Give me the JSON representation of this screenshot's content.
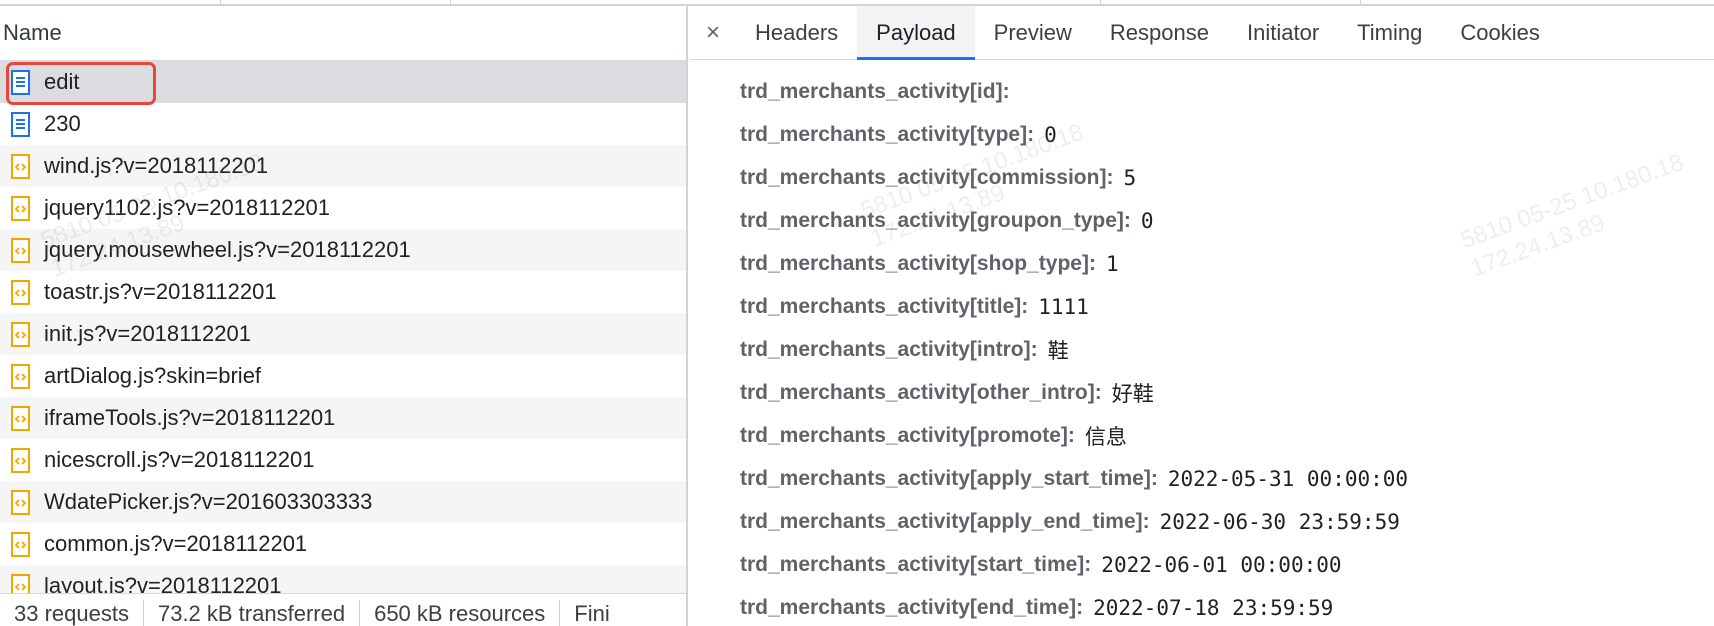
{
  "requests_panel": {
    "column_header": "Name",
    "rows": [
      {
        "name": "edit",
        "icon": "document-icon"
      },
      {
        "name": "230",
        "icon": "document-icon"
      },
      {
        "name": "wind.js?v=2018112201",
        "icon": "script-icon"
      },
      {
        "name": "jquery1102.js?v=2018112201",
        "icon": "script-icon"
      },
      {
        "name": "jquery.mousewheel.js?v=2018112201",
        "icon": "script-icon"
      },
      {
        "name": "toastr.js?v=2018112201",
        "icon": "script-icon"
      },
      {
        "name": "init.js?v=2018112201",
        "icon": "script-icon"
      },
      {
        "name": "artDialog.js?skin=brief",
        "icon": "script-icon"
      },
      {
        "name": "iframeTools.js?v=2018112201",
        "icon": "script-icon"
      },
      {
        "name": "nicescroll.js?v=2018112201",
        "icon": "script-icon"
      },
      {
        "name": "WdatePicker.js?v=201603303333",
        "icon": "script-icon"
      },
      {
        "name": "common.js?v=2018112201",
        "icon": "script-icon"
      },
      {
        "name": "layout.js?v=2018112201",
        "icon": "script-icon"
      }
    ]
  },
  "status_bar": {
    "requests": "33 requests",
    "transferred": "73.2 kB transferred",
    "resources": "650 kB resources",
    "finish": "Fini"
  },
  "detail_panel": {
    "close_label": "×",
    "tabs": [
      "Headers",
      "Payload",
      "Preview",
      "Response",
      "Initiator",
      "Timing",
      "Cookies"
    ],
    "active_tab": "Payload",
    "payload": [
      {
        "key": "trd_merchants_activity[id]:",
        "value": ""
      },
      {
        "key": "trd_merchants_activity[type]:",
        "value": "0"
      },
      {
        "key": "trd_merchants_activity[commission]:",
        "value": "5"
      },
      {
        "key": "trd_merchants_activity[groupon_type]:",
        "value": "0"
      },
      {
        "key": "trd_merchants_activity[shop_type]:",
        "value": "1"
      },
      {
        "key": "trd_merchants_activity[title]:",
        "value": "1111"
      },
      {
        "key": "trd_merchants_activity[intro]:",
        "value": "鞋"
      },
      {
        "key": "trd_merchants_activity[other_intro]:",
        "value": "好鞋"
      },
      {
        "key": "trd_merchants_activity[promote]:",
        "value": "信息"
      },
      {
        "key": "trd_merchants_activity[apply_start_time]:",
        "value": "2022-05-31 00:00:00"
      },
      {
        "key": "trd_merchants_activity[apply_end_time]:",
        "value": "2022-06-30 23:59:59"
      },
      {
        "key": "trd_merchants_activity[start_time]:",
        "value": "2022-06-01 00:00:00"
      },
      {
        "key": "trd_merchants_activity[end_time]:",
        "value": "2022-07-18 23:59:59"
      }
    ]
  },
  "watermark": {
    "line1": "5810 05-25 10.180.18",
    "line2": "172.24.13.89"
  },
  "colors": {
    "highlight": "#e8453c",
    "active_tab_underline": "#1a73e8",
    "document_icon": "#1a73e8",
    "script_icon": "#f2a600"
  }
}
